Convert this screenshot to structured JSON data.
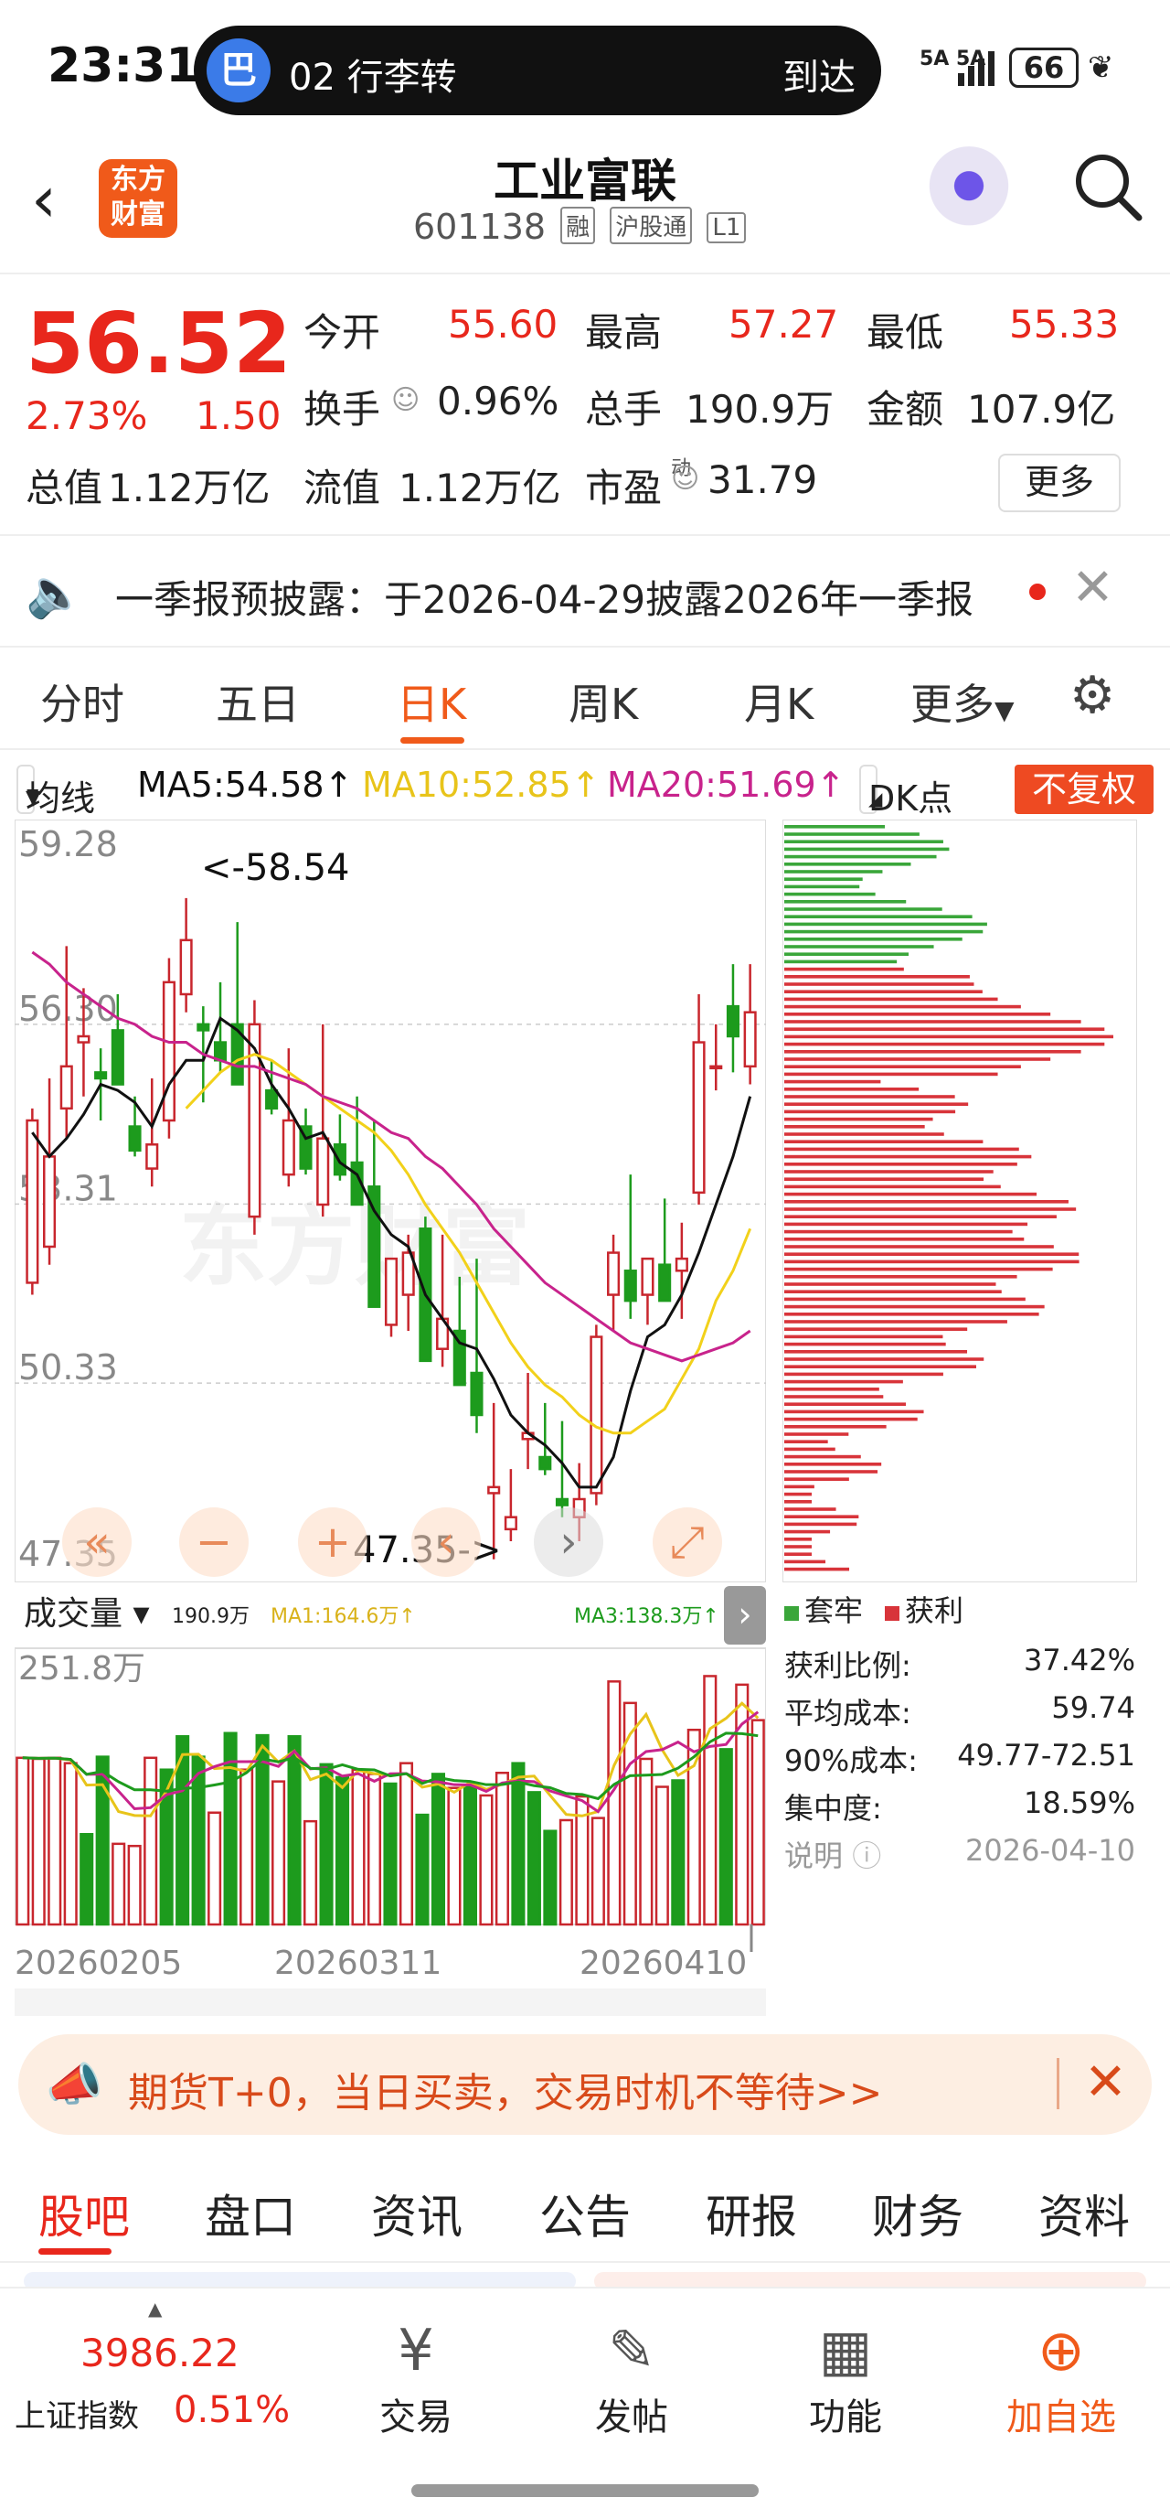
{
  "status_bar": {
    "time": "23:31",
    "pill_icon": "巴",
    "pill_text": "02 行李转",
    "pill_right": "到达",
    "signal": "5A 5A",
    "battery": "66"
  },
  "header": {
    "logo_text": "东方财富",
    "title": "工业富联",
    "code": "601138",
    "tags": [
      "融",
      "沪股通",
      "L1"
    ]
  },
  "quote": {
    "price": "56.52",
    "change_pct": "2.73%",
    "change": "1.50",
    "fields": [
      {
        "label": "今开",
        "value": "55.60",
        "color": "red"
      },
      {
        "label": "最高",
        "value": "57.27",
        "color": "red"
      },
      {
        "label": "最低",
        "value": "55.33",
        "color": "red"
      },
      {
        "label": "换手",
        "value": "0.96%",
        "color": "dark"
      },
      {
        "label": "总手",
        "value": "190.9万",
        "color": "dark"
      },
      {
        "label": "金额",
        "value": "107.9亿",
        "color": "dark"
      },
      {
        "label": "总值",
        "value": "1.12万亿",
        "color": "dark"
      },
      {
        "label": "流值",
        "value": "1.12万亿",
        "color": "dark"
      },
      {
        "label": "市盈",
        "value": "31.79",
        "color": "dark"
      }
    ],
    "pe_sup": "动",
    "more_label": "更多"
  },
  "notice": {
    "text": "一季报预披露：于2026-04-29披露2026年一季报"
  },
  "kline_tabs": {
    "items": [
      "分时",
      "五日",
      "日K",
      "周K",
      "月K",
      "更多"
    ],
    "active": "日K"
  },
  "ma_row": {
    "selector": "均线",
    "ma5": "MA5:54.58↑",
    "ma10": "MA10:52.85↑",
    "ma20": "MA20:51.69↑",
    "dk": "DK点",
    "adjust": "不复权"
  },
  "colors": {
    "up": "#c8262d",
    "down": "#1d9b1d",
    "ma5": "#111111",
    "ma10": "#f2d11a",
    "ma20": "#c8238c",
    "accent": "#f05a1a"
  },
  "chart_data": [
    {
      "type": "candlestick",
      "y_ticks": [
        "59.28",
        "56.30",
        "53.31",
        "50.33",
        "47.35"
      ],
      "annotations": {
        "high": "<-58.54",
        "low": "47.35->"
      },
      "ohlc": [
        [
          52.0,
          54.9,
          51.8,
          54.7
        ],
        [
          52.6,
          55.4,
          52.3,
          54.1
        ],
        [
          54.9,
          57.6,
          54.4,
          55.6
        ],
        [
          56.0,
          56.9,
          55.1,
          56.1
        ],
        [
          55.5,
          55.9,
          54.7,
          55.4
        ],
        [
          56.2,
          56.8,
          55.6,
          55.3
        ],
        [
          54.6,
          55.1,
          54.1,
          54.2
        ],
        [
          53.9,
          55.4,
          53.6,
          54.3
        ],
        [
          54.7,
          57.4,
          54.4,
          57.0
        ],
        [
          56.8,
          58.4,
          56.5,
          57.7
        ],
        [
          56.3,
          56.6,
          55.0,
          56.2
        ],
        [
          56.0,
          57.0,
          55.5,
          55.7
        ],
        [
          56.3,
          58.0,
          55.6,
          55.3
        ],
        [
          53.1,
          56.7,
          52.8,
          56.3
        ],
        [
          55.2,
          55.7,
          54.8,
          54.9
        ],
        [
          53.8,
          55.9,
          53.6,
          54.7
        ],
        [
          54.6,
          54.9,
          53.8,
          53.9
        ],
        [
          53.3,
          56.3,
          53.1,
          54.4
        ],
        [
          54.3,
          54.8,
          53.7,
          53.8
        ],
        [
          54.0,
          55.1,
          53.4,
          53.3
        ],
        [
          53.6,
          54.7,
          53.3,
          51.6
        ],
        [
          51.3,
          52.1,
          51.1,
          52.4
        ],
        [
          51.8,
          52.8,
          51.2,
          52.5
        ],
        [
          52.9,
          53.1,
          50.9,
          50.7
        ],
        [
          50.9,
          52.8,
          50.6,
          51.4
        ],
        [
          51.2,
          52.1,
          50.8,
          50.3
        ],
        [
          50.5,
          52.4,
          49.5,
          49.8
        ],
        [
          48.5,
          50.0,
          47.4,
          48.6
        ],
        [
          47.9,
          48.9,
          47.7,
          48.1
        ],
        [
          49.4,
          50.5,
          48.9,
          49.5
        ],
        [
          49.1,
          50.0,
          48.8,
          48.9
        ],
        [
          48.4,
          49.7,
          48.1,
          48.3
        ],
        [
          48.1,
          49.0,
          47.7,
          48.4
        ],
        [
          48.5,
          51.3,
          48.3,
          51.1
        ],
        [
          51.8,
          52.8,
          51.2,
          52.5
        ],
        [
          52.2,
          53.8,
          51.4,
          51.7
        ],
        [
          51.8,
          52.3,
          51.3,
          52.4
        ],
        [
          52.3,
          53.4,
          51.9,
          51.7
        ],
        [
          52.2,
          53.0,
          51.4,
          52.4
        ],
        [
          53.5,
          56.8,
          53.3,
          56.0
        ],
        [
          55.6,
          56.3,
          55.2,
          55.6
        ],
        [
          56.6,
          57.3,
          55.5,
          56.1
        ],
        [
          55.6,
          57.3,
          55.3,
          56.5
        ]
      ],
      "ma": {
        "MA5": [
          54.5,
          54.1,
          54.4,
          54.8,
          55.3,
          55.2,
          55.0,
          54.6,
          55.3,
          55.7,
          55.7,
          56.4,
          56.2,
          55.9,
          55.3,
          54.9,
          54.4,
          54.5,
          54.0,
          53.8,
          53.2,
          52.8,
          52.6,
          51.8,
          51.4,
          51.0,
          50.9,
          50.4,
          49.8,
          49.5,
          49.3,
          49.0,
          48.6,
          48.6,
          49.1,
          50.2,
          51.1,
          51.3,
          51.8,
          52.5,
          53.3,
          54.1,
          55.1
        ],
        "MA10": [
          null,
          null,
          null,
          null,
          null,
          null,
          null,
          null,
          null,
          54.9,
          55.2,
          55.5,
          55.7,
          55.8,
          55.7,
          55.5,
          55.3,
          55.1,
          54.9,
          54.7,
          54.5,
          54.2,
          53.8,
          53.3,
          52.9,
          52.5,
          52.0,
          51.5,
          51.0,
          50.6,
          50.3,
          50.1,
          49.8,
          49.6,
          49.5,
          49.5,
          49.7,
          49.9,
          50.4,
          50.9,
          51.7,
          52.2,
          52.9
        ],
        "MA20": [
          57.5,
          57.3,
          57.0,
          56.8,
          56.6,
          56.4,
          56.3,
          56.1,
          56.0,
          56.0,
          55.8,
          55.7,
          55.6,
          55.6,
          55.5,
          55.4,
          55.3,
          55.1,
          55.0,
          54.9,
          54.7,
          54.5,
          54.4,
          54.1,
          53.9,
          53.6,
          53.3,
          52.9,
          52.6,
          52.3,
          52.0,
          51.8,
          51.6,
          51.4,
          51.2,
          51.0,
          50.9,
          50.8,
          50.7,
          50.8,
          50.9,
          51.0,
          51.2
        ]
      },
      "chip_legend": [
        "套牢",
        "获利"
      ]
    },
    {
      "type": "bar",
      "title": "成交量",
      "latest": "190.9万",
      "ma1": "MA1:164.6万↑",
      "ma3": "MA3:138.3万↑",
      "y_max_label": "251.8万",
      "x_ticks": [
        "20260205",
        "20260311",
        "20260410"
      ],
      "values_wan": [
        155,
        154,
        155,
        150,
        84,
        156,
        75,
        73,
        155,
        144,
        175,
        156,
        104,
        178,
        144,
        176,
        133,
        175,
        96,
        149,
        137,
        144,
        140,
        131,
        150,
        102,
        140,
        127,
        130,
        120,
        141,
        150,
        123,
        87,
        97,
        119,
        99,
        226,
        206,
        154,
        128,
        134,
        181,
        231,
        163,
        223,
        190
      ]
    }
  ],
  "chip_stats": [
    {
      "label": "获利比例:",
      "value": "37.42%"
    },
    {
      "label": "平均成本:",
      "value": "59.74"
    },
    {
      "label": "90%成本:",
      "value": "49.77-72.51"
    },
    {
      "label": "集中度:",
      "value": "18.59%"
    },
    {
      "label": "说明",
      "value": "2026-04-10"
    }
  ],
  "ad_bar": {
    "text": "期货T+0，当日买卖，交易时机不等待>>"
  },
  "bottom_tabs": {
    "items": [
      "股吧",
      "盘口",
      "资讯",
      "公告",
      "研报",
      "财务",
      "资料"
    ],
    "active": "股吧"
  },
  "bottom_nav": {
    "index_value": "3986.22",
    "index_name": "上证指数",
    "index_pct": "0.51%",
    "items": [
      "交易",
      "发帖",
      "功能",
      "加自选"
    ]
  },
  "watermark": "东方财富"
}
